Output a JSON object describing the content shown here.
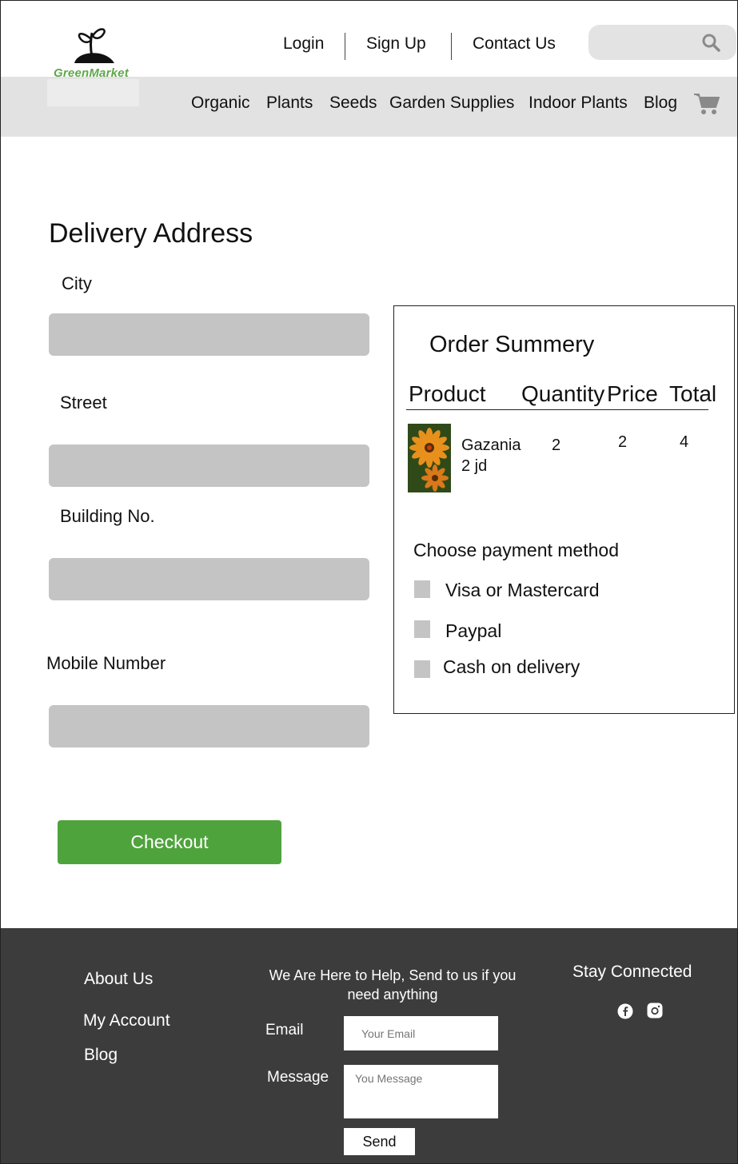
{
  "header": {
    "logo_text": "GreenMarket",
    "top_links": [
      "Login",
      "Sign Up",
      "Contact Us"
    ],
    "nav": [
      "Organic",
      "Plants",
      "Seeds",
      "Garden Supplies",
      "Indoor Plants",
      "Blog"
    ]
  },
  "form": {
    "title": "Delivery Address",
    "fields": [
      {
        "label": "City"
      },
      {
        "label": "Street"
      },
      {
        "label": "Building No."
      },
      {
        "label": "Mobile Number"
      }
    ],
    "checkout_label": "Checkout"
  },
  "summary": {
    "title": "Order Summery",
    "columns": [
      "Product",
      "Quantity",
      "Price",
      "Total"
    ],
    "item": {
      "name": "Gazania",
      "unit_price": "2 jd",
      "quantity": "2",
      "price": "2",
      "total": "4"
    },
    "payment_title": "Choose payment method",
    "payment_options": [
      "Visa or Mastercard",
      "Paypal",
      "Cash on delivery"
    ]
  },
  "footer": {
    "links": [
      "About Us",
      "My Account",
      "Blog"
    ],
    "help_text": "We Are Here to Help, Send to us if you need anything",
    "email_label": "Email",
    "email_placeholder": "Your Email",
    "message_label": "Message",
    "message_placeholder": "You Message",
    "send_label": "Send",
    "stay_connected": "Stay Connected"
  },
  "colors": {
    "accent": "#4fa33c",
    "footer_bg": "#3c3c3c",
    "input_bg": "#c4c4c4",
    "nav_bg": "#e2e2e2"
  },
  "icons": [
    "plant-logo-icon",
    "search-icon",
    "cart-icon",
    "facebook-icon",
    "instagram-icon"
  ]
}
